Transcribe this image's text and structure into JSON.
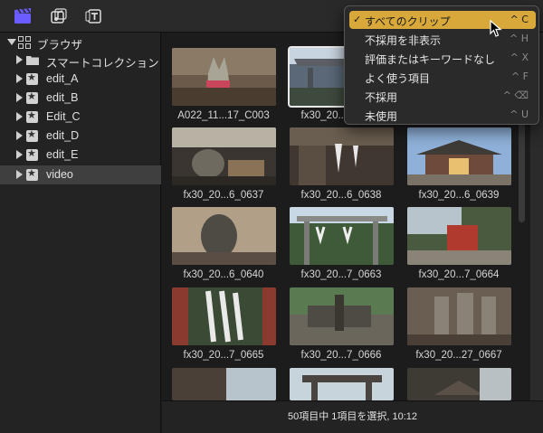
{
  "toolbar": {
    "buttons": [
      {
        "icon": "clapper-icon",
        "color": "#6a5cff"
      },
      {
        "icon": "music-icon",
        "color": "#dddddd"
      },
      {
        "icon": "titles-icon",
        "color": "#dddddd"
      }
    ]
  },
  "sidebar": {
    "header_label": "ブラウザ",
    "items": [
      {
        "label": "スマートコレクション",
        "icon": "folder-icon"
      },
      {
        "label": "edit_A",
        "icon": "keyword-star-icon"
      },
      {
        "label": "edit_B",
        "icon": "keyword-star-icon"
      },
      {
        "label": "Edit_C",
        "icon": "keyword-star-icon"
      },
      {
        "label": "edit_D",
        "icon": "keyword-star-icon"
      },
      {
        "label": "edit_E",
        "icon": "keyword-star-icon"
      },
      {
        "label": "video",
        "icon": "keyword-star-icon",
        "selected": true
      }
    ]
  },
  "clips": [
    {
      "name": "A022_11...17_C003"
    },
    {
      "name": "fx30_20...6_0636",
      "selected": true
    },
    {
      "name": ""
    },
    {
      "name": "fx30_20...6_0637"
    },
    {
      "name": "fx30_20...6_0638"
    },
    {
      "name": "fx30_20...6_0639"
    },
    {
      "name": "fx30_20...6_0640"
    },
    {
      "name": "fx30_20...7_0663"
    },
    {
      "name": "fx30_20...7_0664"
    },
    {
      "name": "fx30_20...7_0665"
    },
    {
      "name": "fx30_20...7_0666"
    },
    {
      "name": "fx30_20...27_0667"
    },
    {
      "name": ""
    },
    {
      "name": ""
    },
    {
      "name": ""
    }
  ],
  "status": {
    "text": "50項目中 1項目を選択, 10:12"
  },
  "filter_menu": {
    "items": [
      {
        "label": "すべてのクリップ",
        "shortcut": "^ C",
        "checked": true,
        "highlighted": true
      },
      {
        "label": "不採用を非表示",
        "shortcut": "^ H"
      },
      {
        "label": "評価またはキーワードなし",
        "shortcut": "^ X"
      },
      {
        "label": "よく使う項目",
        "shortcut": "^ F"
      },
      {
        "label": "不採用",
        "shortcut": "^ ⌫"
      },
      {
        "label": "未使用",
        "shortcut": "^ U"
      }
    ],
    "check_glyph": "✓"
  },
  "colors": {
    "menu_highlight": "#d8a93a",
    "selection": "#3f3f3f"
  }
}
